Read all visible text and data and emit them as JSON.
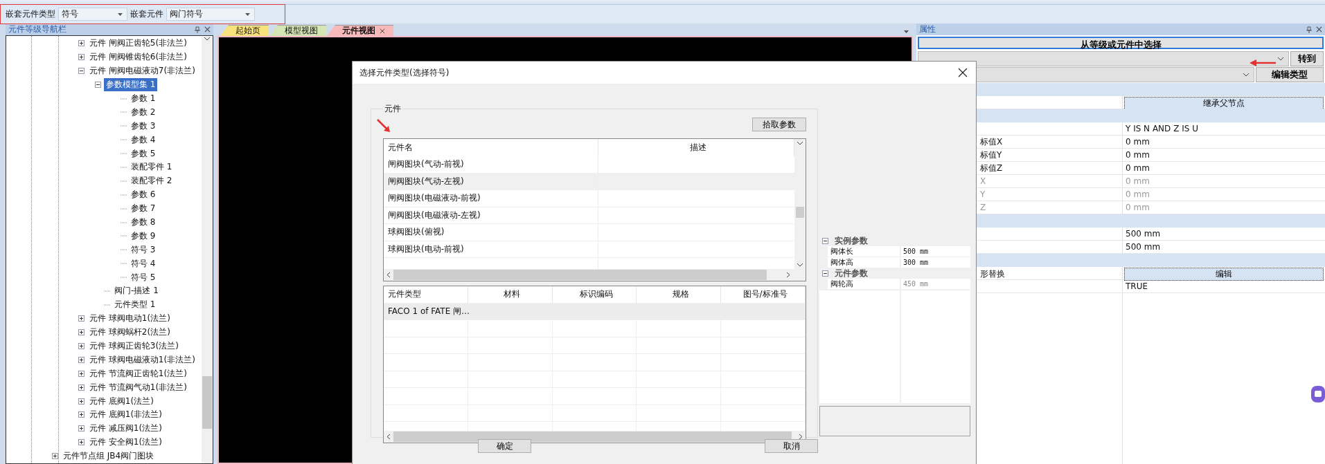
{
  "toolbar": {
    "fields": [
      {
        "label": "嵌套元件类型",
        "value": "符号"
      },
      {
        "label": "嵌套元件",
        "value": "阀门符号"
      }
    ]
  },
  "navigator": {
    "title": "元件等级导航栏",
    "tree": [
      {
        "label": "元件 闸阀正齿轮5(非法兰)",
        "expanded": false,
        "selected": false
      },
      {
        "label": "元件 闸阀锥齿轮6(非法兰)",
        "expanded": false,
        "selected": false
      },
      {
        "label": "元件 闸阀电磁液动7(非法兰)",
        "expanded": true,
        "selected": false,
        "children": [
          {
            "label": "参数模型集 1",
            "expanded": true,
            "selected": true,
            "children": [
              {
                "label": "参数 1",
                "selected": false
              },
              {
                "label": "参数 2",
                "selected": false
              },
              {
                "label": "参数 3",
                "selected": false
              },
              {
                "label": "参数 4",
                "selected": false
              },
              {
                "label": "参数 5",
                "selected": false
              },
              {
                "label": "装配零件 1",
                "selected": false
              },
              {
                "label": "装配零件 2",
                "selected": false
              },
              {
                "label": "参数 6",
                "selected": false
              },
              {
                "label": "参数 7",
                "selected": false
              },
              {
                "label": "参数 8",
                "selected": false
              },
              {
                "label": "参数 9",
                "selected": false
              },
              {
                "label": "符号 3",
                "selected": false
              },
              {
                "label": "符号 4",
                "selected": false
              },
              {
                "label": "符号 5",
                "selected": false
              }
            ]
          },
          {
            "label": "阀门-描述 1",
            "selected": false
          },
          {
            "label": "元件类型 1",
            "selected": false
          }
        ]
      },
      {
        "label": "元件 球阀电动1(法兰)",
        "expanded": false,
        "selected": false
      },
      {
        "label": "元件 球阀蜗杆2(法兰)",
        "expanded": false,
        "selected": false
      },
      {
        "label": "元件 球阀正齿轮3(法兰)",
        "expanded": false,
        "selected": false
      },
      {
        "label": "元件 球阀电磁液动1(非法兰)",
        "expanded": false,
        "selected": false
      },
      {
        "label": "元件 节流阀正齿轮1(法兰)",
        "expanded": false,
        "selected": false
      },
      {
        "label": "元件 节流阀气动1(非法兰)",
        "expanded": false,
        "selected": false
      },
      {
        "label": "元件 底阀1(法兰)",
        "expanded": false,
        "selected": false
      },
      {
        "label": "元件 底阀1(非法兰)",
        "expanded": false,
        "selected": false
      },
      {
        "label": "元件 减压阀1(法兰)",
        "expanded": false,
        "selected": false
      },
      {
        "label": "元件 安全阀1(法兰)",
        "expanded": false,
        "selected": false
      }
    ],
    "outer_items": [
      {
        "label": "元件节点组 JB4阀门图块",
        "expanded": false,
        "selected": false
      }
    ]
  },
  "tabs": [
    {
      "label": "起始页",
      "color": "#f8e27c",
      "selected": false
    },
    {
      "label": "模型视图",
      "color": "#d4e6b5",
      "selected": false
    },
    {
      "label": "元件视图",
      "color": "#f7b9b9",
      "selected": true
    }
  ],
  "properties": {
    "title": "属性",
    "select_button": "从等级或元件中选择",
    "goto_button": "转到",
    "edit_type_button": "编辑类型",
    "rows": [
      {
        "kind": "section"
      },
      {
        "kind": "button",
        "value": "继承父节点"
      },
      {
        "kind": "section"
      },
      {
        "kind": "text",
        "value": "Y IS N AND Z IS U",
        "disabled": false
      },
      {
        "kind": "text",
        "label": "标值X",
        "value": "0 mm",
        "disabled": false
      },
      {
        "kind": "text",
        "label": "标值Y",
        "value": "0 mm",
        "disabled": false
      },
      {
        "kind": "text",
        "label": "标值Z",
        "value": "0 mm",
        "disabled": false
      },
      {
        "kind": "text",
        "label": "X",
        "value": "0 mm",
        "disabled": true
      },
      {
        "kind": "text",
        "label": "Y",
        "value": "0 mm",
        "disabled": true
      },
      {
        "kind": "text",
        "label": "Z",
        "value": "0 mm",
        "disabled": true
      },
      {
        "kind": "section"
      },
      {
        "kind": "text",
        "value": "500 mm",
        "disabled": false
      },
      {
        "kind": "text",
        "value": "500 mm",
        "disabled": false
      },
      {
        "kind": "section"
      },
      {
        "kind": "button",
        "label": "形替换",
        "value": "编辑"
      },
      {
        "kind": "text",
        "value": "TRUE",
        "disabled": false
      }
    ]
  },
  "dialog": {
    "title": "选择元件类型(选择符号)",
    "group_title": "元件",
    "pick_button": "拾取参数",
    "list": {
      "columns": [
        "元件名",
        "描述"
      ],
      "rows": [
        {
          "name": "闸阀图块(气动-前视)",
          "selected": false
        },
        {
          "name": "闸阀图块(气动-左视)",
          "selected": true
        },
        {
          "name": "闸阀图块(电磁液动-前视)",
          "selected": false
        },
        {
          "name": "闸阀图块(电磁液动-左视)",
          "selected": false
        },
        {
          "name": "球阀图块(俯视)",
          "selected": false
        },
        {
          "name": "球阀图块(电动-前视)",
          "selected": false
        }
      ]
    },
    "table": {
      "columns": [
        "元件类型",
        "材料",
        "标识编码",
        "规格",
        "图号/标准号"
      ],
      "rows": [
        {
          "cells": [
            "FACO 1 of FATE 闸…"
          ],
          "selected": true
        }
      ]
    },
    "params": {
      "groups": [
        {
          "title": "实例参数",
          "expanded": true,
          "rows": [
            {
              "name": "阀体长",
              "value": "500 mm",
              "disabled": false
            },
            {
              "name": "阀体高",
              "value": "300 mm",
              "disabled": false
            }
          ]
        },
        {
          "title": "元件参数",
          "expanded": true,
          "rows": [
            {
              "name": "阀轮高",
              "value": "450 mm",
              "disabled": true
            }
          ]
        }
      ]
    },
    "buttons": [
      "确定",
      "取消"
    ]
  },
  "annotations": [
    {
      "kind": "frame"
    },
    {
      "kind": "arrow"
    },
    {
      "kind": "arrow"
    }
  ]
}
